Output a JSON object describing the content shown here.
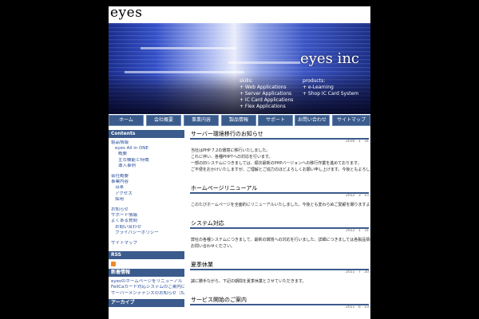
{
  "header": {
    "logo": "eyes",
    "brand": "eyes inc",
    "skills_title": "skills:",
    "skills": [
      "+ Web Applications",
      "+ Server Applications",
      "+ IC Card Applications",
      "+ Flex Applications"
    ],
    "products_title": "products:",
    "products": [
      "+ e-Learning",
      "+ Shop IC Card System"
    ]
  },
  "nav": [
    "ホーム",
    "会社概要",
    "事業内容",
    "製品情報",
    "サポート",
    "お問い合わせ",
    "サイトマップ"
  ],
  "sidebar": {
    "contents_title": "Contents",
    "group1": [
      "製品情報",
      "eyes All in ONE",
      "概要",
      "主な機能と特徴",
      "導入事例"
    ],
    "group2": [
      "会社概要",
      "事業内容",
      "沿革",
      "アクセス",
      "採用"
    ],
    "group3": [
      "お知らせ",
      "サポート情報",
      "よくある質問",
      "お問い合わせ",
      "プライバシーポリシー"
    ],
    "group4": [
      "サイトマップ"
    ],
    "rss_title": "RSS",
    "news_title": "新着情報",
    "news": [
      "eyesのホームページをリニューアル",
      "FeliCaカード対応システムのご案内について",
      "サーバーメンテナンスのお知らせ（5/10）"
    ],
    "archive_title": "アーカイブ"
  },
  "posts": [
    {
      "title": "サーバー環境移行のお知らせ",
      "date": "2016　1　31",
      "body": [
        "当社はPHP 7.2の環境に移行いたしました。",
        "これに伴い、各種PHP7への対応を行います。",
        "一部の旧システムにつきましては、順次最新のPHPバージョンへの移行作業を進めております。",
        "ご不便をおかけいたしますが、ご理解とご協力のほどよろしくお願い申し上げます。今後ともよろしくお願いいたします。"
      ]
    },
    {
      "title": "ホームページリニューアル",
      "date": "2012　3　15",
      "body": [
        "このたびホームページを全面的にリニューアルいたしました。今後とも変わらぬご愛顧を賜りますようお願い申し上げます。"
      ]
    },
    {
      "title": "システム対応",
      "date": "2012　1　31",
      "body": [
        "弊社の各種システムにつきまして、最新の環境への対応を行いました。詳細につきましては各製品情報ページをご覧ください。ご不明な点がございましたらお気軽に",
        "お問い合わせください。"
      ]
    },
    {
      "title": "夏季休業",
      "date": "2011　7　20",
      "body": [
        "誠に勝手ながら、下記の期間を夏季休業とさせていただきます。"
      ]
    },
    {
      "title": "サービス開始のご案内",
      "date": "2011　6　23",
      "body": []
    }
  ]
}
